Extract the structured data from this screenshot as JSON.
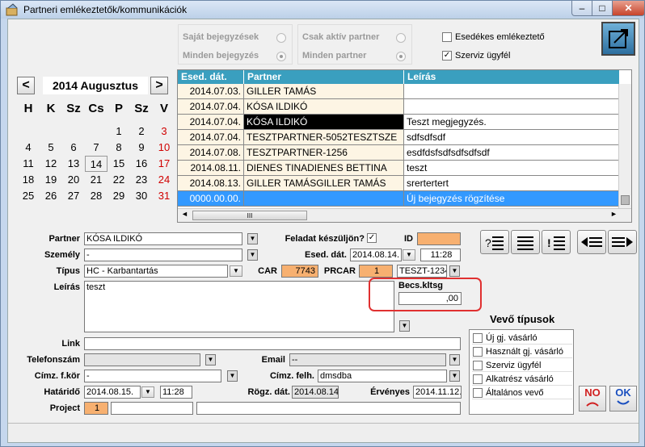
{
  "window": {
    "title": "Partneri emlékeztetők/kommunikációk",
    "minimize": "–",
    "maximize": "□",
    "close": "✕"
  },
  "filters": {
    "sajat_bejegyzesek": "Saját bejegyzések",
    "minden_bejegyzes": "Minden bejegyzés",
    "csak_aktiv_partner": "Csak aktív partner",
    "minden_partner": "Minden partner",
    "esedekes": "Esedékes emlékeztető",
    "szerviz": "Szerviz ügyfél",
    "szerviz_checked": "✓",
    "esedekes_checked": ""
  },
  "calendar": {
    "prev": "<",
    "next": ">",
    "title": "2014 Augusztus",
    "headers": [
      "H",
      "K",
      "Sz",
      "Cs",
      "P",
      "Sz",
      "V"
    ],
    "weeks": [
      [
        "",
        "",
        "",
        "",
        "1",
        "2",
        "3"
      ],
      [
        "4",
        "5",
        "6",
        "7",
        "8",
        "9",
        "10"
      ],
      [
        "11",
        "12",
        "13",
        "14",
        "15",
        "16",
        "17"
      ],
      [
        "18",
        "19",
        "20",
        "21",
        "22",
        "23",
        "24"
      ],
      [
        "25",
        "26",
        "27",
        "28",
        "29",
        "30",
        "31"
      ]
    ],
    "today": "14"
  },
  "grid": {
    "columns": [
      "Esed. dát.",
      "Partner",
      "Leírás"
    ],
    "rows": [
      {
        "date": "2014.07.03.",
        "partner": "GILLER TAMÁS",
        "desc": ""
      },
      {
        "date": "2014.07.04.",
        "partner": "KÓSA ILDIKÓ",
        "desc": ""
      },
      {
        "date": "2014.07.04.",
        "partner": "KÓSA ILDIKÓ",
        "desc": "Teszt megjegyzés."
      },
      {
        "date": "2014.07.04.",
        "partner": "TESZTPARTNER-5052TESZTSZE",
        "desc": "sdfsdfsdf"
      },
      {
        "date": "2014.07.08.",
        "partner": "TESZTPARTNER-1256",
        "desc": "esdfdsfsdfsdfsdfsdf"
      },
      {
        "date": "2014.08.11.",
        "partner": "DIENES TINADIENES BETTINA",
        "desc": "teszt"
      },
      {
        "date": "2014.08.13.",
        "partner": "GILLER TAMÁSGILLER TAMÁS",
        "desc": "srertertert"
      },
      {
        "date": "0000.00.00.",
        "partner": "",
        "desc": "Új bejegyzés rögzítése"
      }
    ],
    "hscroll_grip": "III"
  },
  "form": {
    "partner_label": "Partner",
    "partner_value": "KÓSA ILDIKÓ",
    "feladat_label": "Feladat készüljön?",
    "feladat_checked": "✓",
    "id_label": "ID",
    "id_value": "",
    "szemely_label": "Személy",
    "szemely_value": "-",
    "esed_label": "Esed. dát.",
    "esed_value": "2014.08.14.",
    "esed_time": "11:28",
    "tipus_label": "Típus",
    "tipus_value": "HC - Karbantartás",
    "car_label": "CAR",
    "car_value": "7743",
    "prcar_label": "PRCAR",
    "prcar_value": "1",
    "teszt_value": "TESZT-1234",
    "leiras_label": "Leírás",
    "leiras_value": "teszt",
    "becs_label": "Becs.kltsg",
    "becs_value": ",00",
    "link_label": "Link",
    "link_value": "",
    "telefon_label": "Telefonszám",
    "telefon_value": "",
    "email_label": "Email",
    "email_value": "--",
    "cimz_fkor_label": "Címz. f.kör",
    "cimz_fkor_value": "-",
    "cimz_felh_label": "Címz. felh.",
    "cimz_felh_value": "dmsdba",
    "hatarido_label": "Határidő",
    "hatarido_value": "2014.08.15.",
    "hatarido_time": "11:28",
    "rogz_label": "Rögz. dát.",
    "rogz_value": "2014.08.14.",
    "ervenyes_label": "Érvényes",
    "ervenyes_value": "2014.11.12.",
    "project_label": "Project",
    "project_value": "1"
  },
  "vevo": {
    "title": "Vevő típusok",
    "items": [
      "Új gj. vásárló",
      "Használt gj. vásárló",
      "Szerviz ügyfél",
      "Alkatrész vásárló",
      "Általános vevő"
    ]
  },
  "buttons": {
    "no": "NO",
    "ok": "OK"
  },
  "colors": {
    "header": "#3a9fbf",
    "selection": "#3399ff",
    "orange": "#f7b070",
    "highlight": "#e03030"
  }
}
